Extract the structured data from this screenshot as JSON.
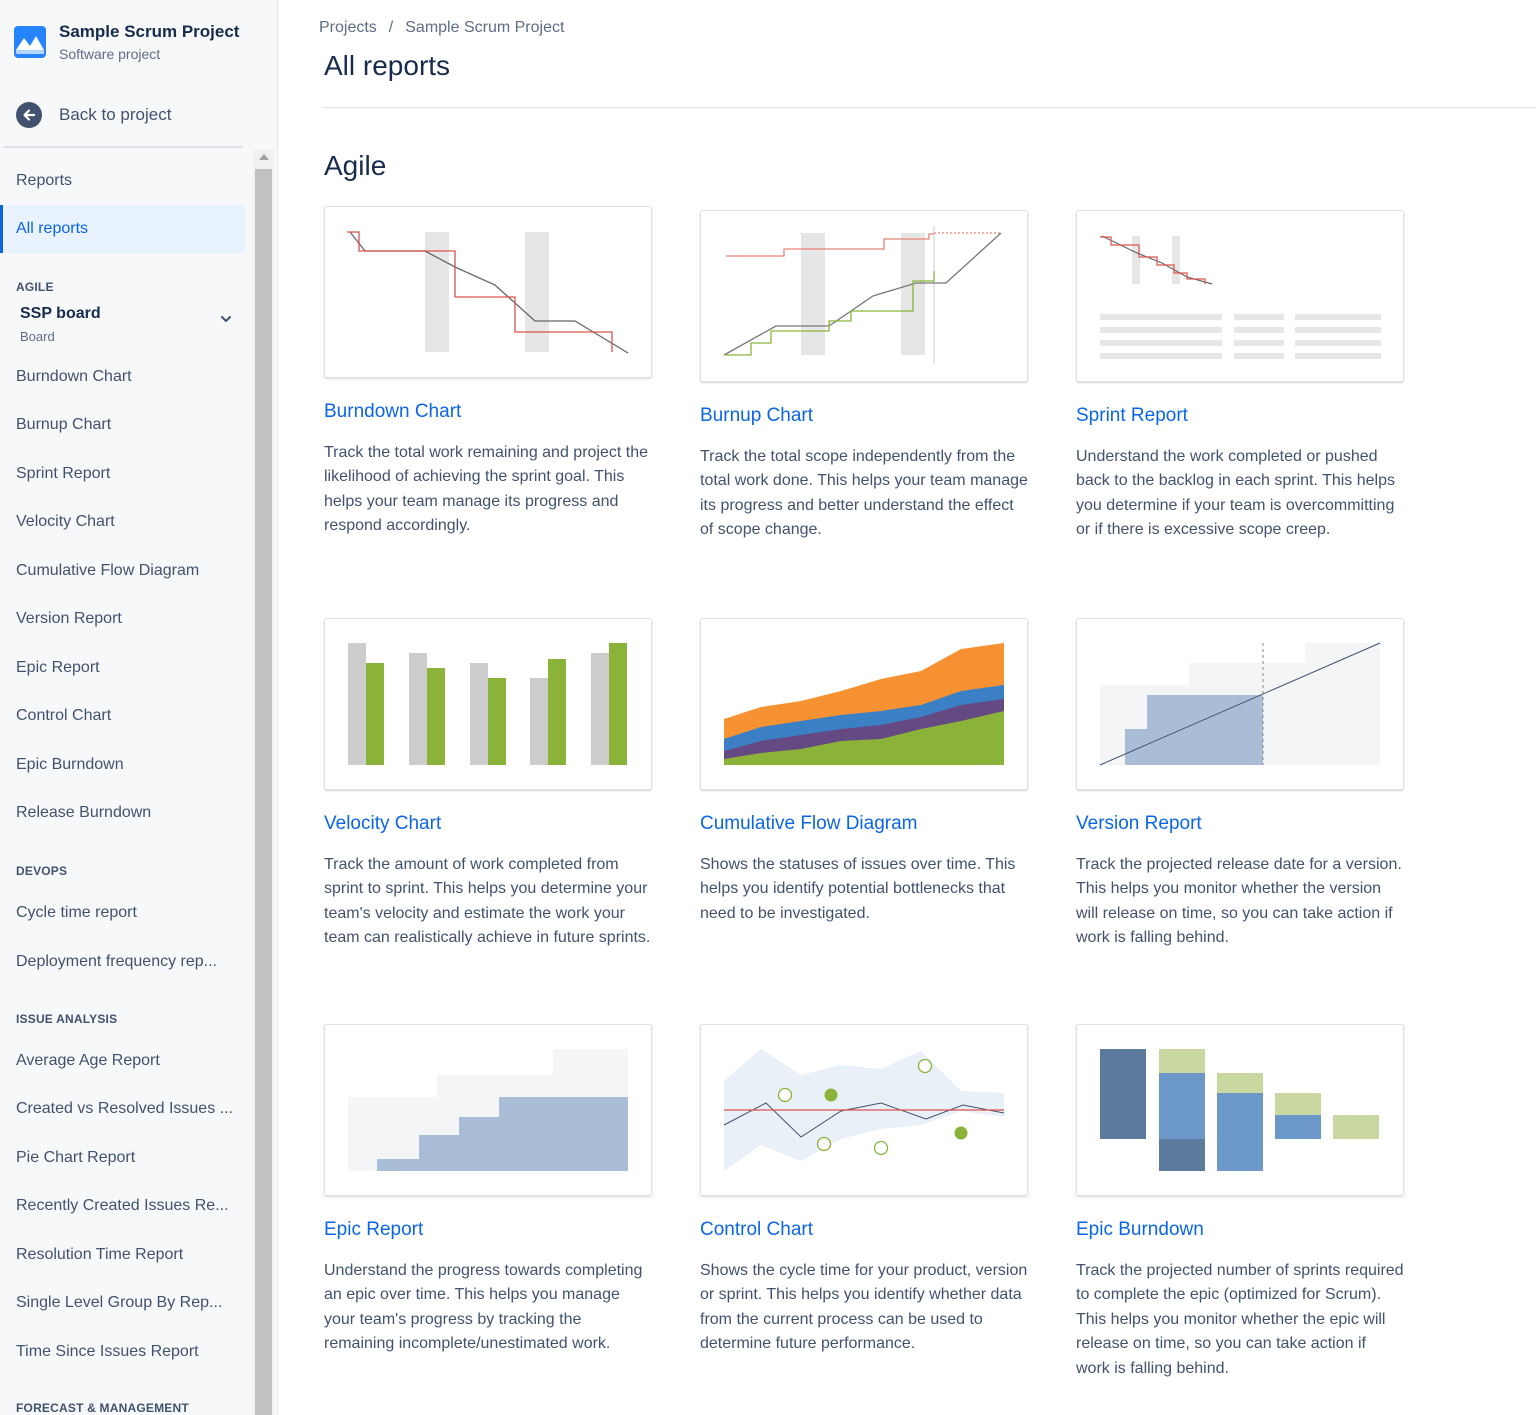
{
  "sidebar": {
    "project_name": "Sample Scrum Project",
    "project_type": "Software project",
    "back_label": "Back to project",
    "reports_heading": "Reports",
    "all_reports_label": "All reports",
    "agile_label": "AGILE",
    "board_name": "SSP board",
    "board_type": "Board",
    "agile_items": [
      "Burndown Chart",
      "Burnup Chart",
      "Sprint Report",
      "Velocity Chart",
      "Cumulative Flow Diagram",
      "Version Report",
      "Epic Report",
      "Control Chart",
      "Epic Burndown",
      "Release Burndown"
    ],
    "devops_label": "DEVOPS",
    "devops_items": [
      "Cycle time report",
      "Deployment frequency rep..."
    ],
    "issue_label": "ISSUE ANALYSIS",
    "issue_items": [
      "Average Age Report",
      "Created vs Resolved Issues ...",
      "Pie Chart Report",
      "Recently Created Issues Re...",
      "Resolution Time Report",
      "Single Level Group By Rep...",
      "Time Since Issues Report"
    ],
    "forecast_label": "FORECAST & MANAGEMENT"
  },
  "breadcrumb": {
    "projects": "Projects",
    "separator": "/",
    "project": "Sample Scrum Project"
  },
  "page_title": "All reports",
  "section_title": "Agile",
  "cards": [
    {
      "title": "Burndown Chart",
      "desc": "Track the total work remaining and project the likelihood of achieving the sprint goal. This helps your team manage its progress and respond accordingly."
    },
    {
      "title": "Burnup Chart",
      "desc": "Track the total scope independently from the total work done. This helps your team manage its progress and better understand the effect of scope change."
    },
    {
      "title": "Sprint Report",
      "desc": "Understand the work completed or pushed back to the backlog in each sprint. This helps you determine if your team is overcommitting or if there is excessive scope creep."
    },
    {
      "title": "Velocity Chart",
      "desc": "Track the amount of work completed from sprint to sprint. This helps you determine your team's velocity and estimate the work your team can realistically achieve in future sprints."
    },
    {
      "title": "Cumulative Flow Diagram",
      "desc": "Shows the statuses of issues over time. This helps you identify potential bottlenecks that need to be investigated."
    },
    {
      "title": "Version Report",
      "desc": "Track the projected release date for a version. This helps you monitor whether the version will release on time, so you can take action if work is falling behind."
    },
    {
      "title": "Epic Report",
      "desc": "Understand the progress towards completing an epic over time. This helps you manage your team's progress by tracking the remaining incomplete/unestimated work."
    },
    {
      "title": "Control Chart",
      "desc": "Shows the cycle time for your product, version or sprint. This helps you identify whether data from the current process can be used to determine future performance."
    },
    {
      "title": "Epic Burndown",
      "desc": "Track the projected number of sprints required to complete the epic (optimized for Scrum). This helps you monitor whether the epic will release on time, so you can take action if work is falling behind."
    }
  ],
  "colors": {
    "link": "#0c66e4",
    "green": "#8bb33a",
    "red": "#d9534f",
    "gray": "#e6e6e6",
    "orange": "#f79232",
    "blue": "#3b7fc4",
    "purple": "#654982"
  }
}
